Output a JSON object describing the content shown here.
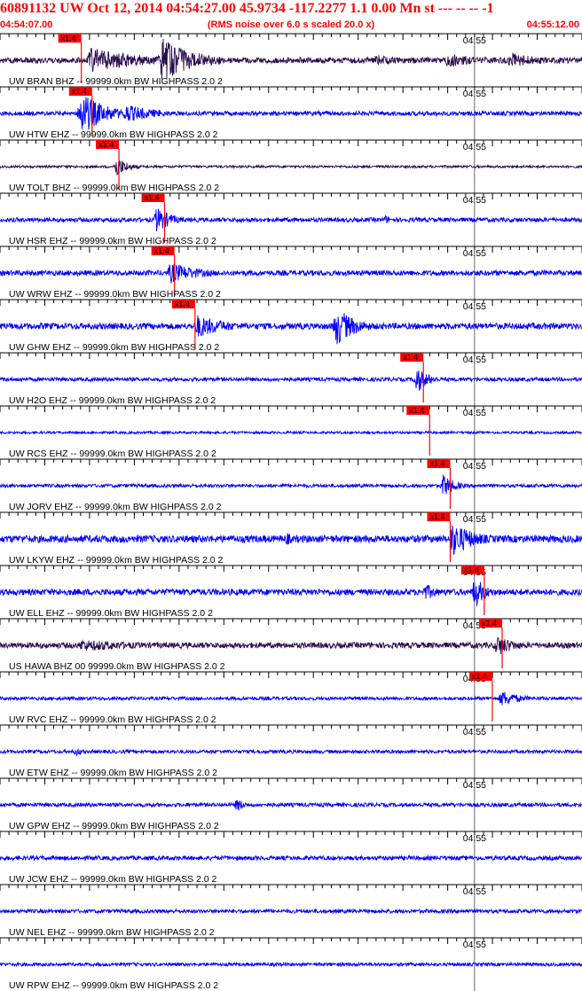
{
  "header": {
    "title": "60891132 UW Oct 12, 2014 04:54:27.00   45.9734 -117.2277  1.1 0.00 Mn st --- -- --  -1",
    "start_time": "04:54:07.00",
    "note": "(RMS noise over 6.0 s scaled 20.0 x)",
    "end_time": "04:55:12.00"
  },
  "colors": {
    "background": "#ffffff",
    "trace_blue": "#0000ff",
    "trace_dark": "#2a0a4e",
    "pick_red": "#ff0000",
    "grid_black": "#000000",
    "header_red": "#ff0000"
  },
  "chart_data": {
    "type": "seismogram",
    "time_axis": {
      "start": "04:54:07.00",
      "end": "04:55:12.00",
      "seconds": 65,
      "tick_interval_s": 1,
      "major_tick_label": "04:55",
      "major_tick_time_s": 53
    },
    "pick_label": "x1.4",
    "traces": [
      {
        "label": "UW BRAN BHZ -- 99999.0km BW  HIGHPASS  2.0  2",
        "color": "dark",
        "pick_s": 7.3,
        "events": [
          {
            "t": 10,
            "amp": 0.55,
            "dur": 14
          },
          {
            "t": 18,
            "amp": 0.95,
            "dur": 8
          },
          {
            "t": 42,
            "amp": 0.25,
            "dur": 6
          },
          {
            "t": 50,
            "amp": 0.3,
            "dur": 10
          },
          {
            "t": 57,
            "amp": 0.35,
            "dur": 8
          }
        ],
        "noise": 0.12
      },
      {
        "label": "UW HTW EHZ -- 99999.0km BW  HIGHPASS  2.0  2",
        "color": "blue",
        "pick_s": 8.5,
        "events": [
          {
            "t": 9,
            "amp": 0.95,
            "dur": 6
          },
          {
            "t": 14,
            "amp": 0.4,
            "dur": 8
          }
        ],
        "noise": 0.09
      },
      {
        "label": "UW TOLT BHZ -- 99999.0km BW  HIGHPASS  2.0  2",
        "color": "dark",
        "pick_s": 11.5,
        "events": [
          {
            "t": 13,
            "amp": 0.45,
            "dur": 3
          }
        ],
        "noise": 0.05
      },
      {
        "label": "UW HSR EHZ -- 99999.0km BW  HIGHPASS  2.0  2",
        "color": "blue",
        "pick_s": 16.6,
        "events": [
          {
            "t": 17.5,
            "amp": 0.55,
            "dur": 4
          },
          {
            "t": 43,
            "amp": 0.2,
            "dur": 2
          }
        ],
        "noise": 0.09
      },
      {
        "label": "UW WRW EHZ -- 99999.0km BW  HIGHPASS  2.0  2",
        "color": "blue",
        "pick_s": 17.7,
        "events": [
          {
            "t": 19,
            "amp": 0.45,
            "dur": 8
          }
        ],
        "noise": 0.11
      },
      {
        "label": "UW GHW EHZ -- 99999.0km BW  HIGHPASS  2.0  2",
        "color": "blue",
        "pick_s": 20.0,
        "events": [
          {
            "t": 22,
            "amp": 0.5,
            "dur": 8
          },
          {
            "t": 37.5,
            "amp": 0.85,
            "dur": 5
          }
        ],
        "noise": 0.13
      },
      {
        "label": "UW H2O EHZ -- 99999.0km BW  HIGHPASS  2.0  2",
        "color": "blue",
        "pick_s": 45.5,
        "events": [
          {
            "t": 46.5,
            "amp": 0.6,
            "dur": 3
          }
        ],
        "noise": 0.08
      },
      {
        "label": "UW RCS EHZ -- 99999.0km BW  HIGHPASS  2.0  2",
        "color": "blue",
        "pick_s": 46.2,
        "events": [],
        "noise": 0.05
      },
      {
        "label": "UW JORV EHZ -- 99999.0km BW  HIGHPASS  2.0  2",
        "color": "blue",
        "pick_s": 48.5,
        "events": [
          {
            "t": 49.5,
            "amp": 0.5,
            "dur": 3
          }
        ],
        "noise": 0.07
      },
      {
        "label": "UW LKYW EHZ -- 99999.0km BW  HIGHPASS  2.0  2",
        "color": "blue",
        "pick_s": 48.5,
        "events": [
          {
            "t": 32,
            "amp": 0.3,
            "dur": 2
          },
          {
            "t": 50.5,
            "amp": 0.75,
            "dur": 6
          }
        ],
        "noise": 0.15
      },
      {
        "label": "UW ELL EHZ -- 99999.0km BW  HIGHPASS  2.0  2",
        "color": "blue",
        "pick_s": 52.3,
        "events": [
          {
            "t": 47.5,
            "amp": 0.35,
            "dur": 4
          },
          {
            "t": 53,
            "amp": 0.7,
            "dur": 3
          }
        ],
        "noise": 0.13
      },
      {
        "label": "US HAWA BHZ 00 99999.0km BW  HIGHPASS  2.0  2",
        "color": "dark",
        "pick_s": 54.3,
        "events": [
          {
            "t": 9,
            "amp": 0.25,
            "dur": 22
          },
          {
            "t": 55.5,
            "amp": 0.45,
            "dur": 5
          }
        ],
        "noise": 0.12
      },
      {
        "label": "UW RVC EHZ -- 99999.0km BW  HIGHPASS  2.0  2",
        "color": "blue",
        "pick_s": 53.2,
        "events": [
          {
            "t": 56,
            "amp": 0.35,
            "dur": 5
          }
        ],
        "noise": 0.07
      },
      {
        "label": "UW ETW EHZ -- 99999.0km BW  HIGHPASS  2.0  2",
        "color": "blue",
        "pick_s": null,
        "events": [
          {
            "t": 8.5,
            "amp": 0.2,
            "dur": 2
          }
        ],
        "noise": 0.07
      },
      {
        "label": "UW GPW EHZ -- 99999.0km BW  HIGHPASS  2.0  2",
        "color": "blue",
        "pick_s": null,
        "events": [
          {
            "t": 26.5,
            "amp": 0.3,
            "dur": 2
          }
        ],
        "noise": 0.08
      },
      {
        "label": "UW JCW EHZ -- 99999.0km BW  HIGHPASS  2.0  2",
        "color": "blue",
        "pick_s": null,
        "events": [],
        "noise": 0.09
      },
      {
        "label": "UW NEL EHZ -- 99999.0km BW  HIGHPASS  2.0  2",
        "color": "blue",
        "pick_s": null,
        "events": [],
        "noise": 0.08
      },
      {
        "label": "UW RPW EHZ -- 99999.0km BW  HIGHPASS  2.0  2",
        "color": "blue",
        "pick_s": null,
        "events": [],
        "noise": 0.07
      }
    ]
  }
}
